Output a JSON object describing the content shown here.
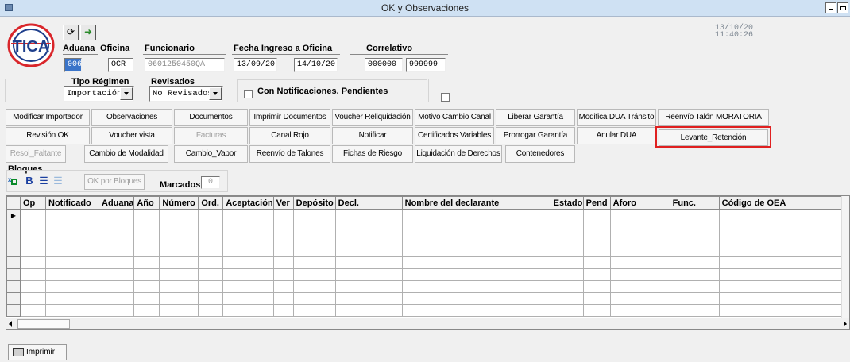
{
  "window": {
    "title": "OK y Observaciones"
  },
  "clock": {
    "date": "13/10/20",
    "time": "11:40:26"
  },
  "header": {
    "aduana": {
      "label": "Aduana",
      "value": "006"
    },
    "oficina": {
      "label": "Oficina",
      "value": "OCR"
    },
    "funcionario": {
      "label": "Funcionario",
      "value": "0601250450QA"
    },
    "fecha": {
      "label": "Fecha Ingreso a Oficina",
      "from": "13/09/20",
      "to": "14/10/20"
    },
    "correlativo": {
      "label": "Correlativo",
      "from": "000000",
      "to": "999999"
    },
    "tipo_regimen": {
      "label": "Tipo Régimen",
      "value": "Importación"
    },
    "revisados": {
      "label": "Revisados",
      "value": "No Revisados"
    },
    "notificaciones": {
      "label": "Con Notificaciones. Pendientes"
    }
  },
  "actions": {
    "row1": [
      "Modificar Importador",
      "Observaciones",
      "Documentos",
      "Imprimir Documentos",
      "Voucher Reliquidación",
      "Motivo Cambio Canal",
      "Liberar Garantía",
      "Modifica DUA Tránsito",
      "Reenvío Talón MORATORIA"
    ],
    "row2": [
      "Revisión OK",
      "Voucher vista",
      "Facturas",
      "Canal Rojo",
      "Notificar",
      "Certificados Variables",
      "Prorrogar Garantía",
      "Anular DUA",
      "Levante_Retención"
    ],
    "row3": [
      "Resol_Faltante",
      "Cambio de Modalidad",
      "Cambio_Vapor",
      "Reenvío de Talones",
      "Fichas de Riesgo",
      "Liquidación de Derechos",
      "Contenedores"
    ]
  },
  "bloques": {
    "label": "Bloques",
    "ok_button": "OK por Bloques",
    "marcados_label": "Marcados",
    "marcados_value": "0"
  },
  "grid": {
    "columns": [
      "Op",
      "Notificado",
      "Aduana",
      "Año",
      "Número",
      "Ord.",
      "Aceptación",
      "Ver",
      "Depósito",
      "Decl.",
      "Nombre del declarante",
      "Estado",
      "Pend",
      "Aforo",
      "Func.",
      "Código de OEA"
    ]
  },
  "footer": {
    "print_label": "Imprimir"
  }
}
